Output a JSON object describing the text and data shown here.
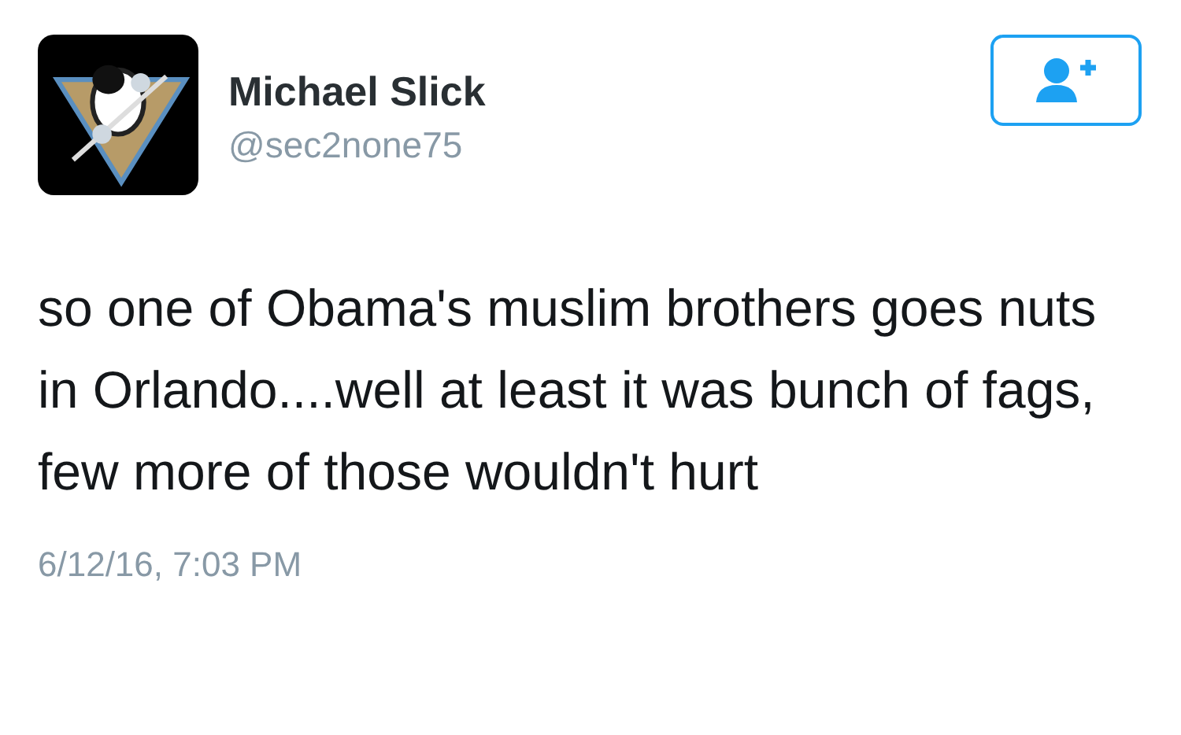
{
  "user": {
    "name": "Michael Slick",
    "handle": "@sec2none75"
  },
  "follow_button": {
    "kind": "follow"
  },
  "tweet": {
    "text": "so one of Obama's muslim brothers goes nuts in Orlando....well at least it was bunch of fags, few more of those wouldn't hurt",
    "timestamp": "6/12/16, 7:03 PM"
  }
}
